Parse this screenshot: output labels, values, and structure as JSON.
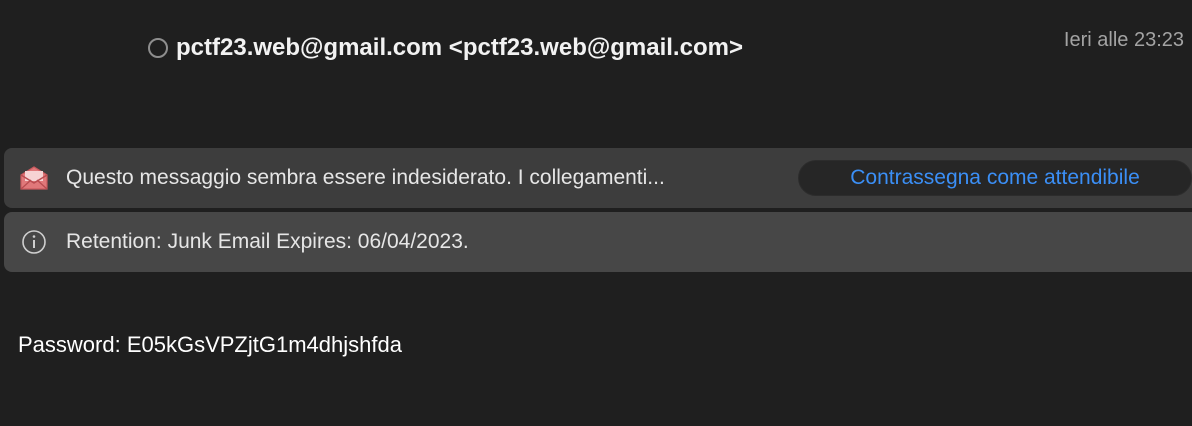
{
  "header": {
    "sender": "pctf23.web@gmail.com <pctf23.web@gmail.com>",
    "date": "Ieri alle 23:23"
  },
  "junk_banner": {
    "icon": "junk-envelope-icon",
    "text": "Questo messaggio sembra essere indesiderato. I collegamenti...",
    "button_label": "Contrassegna come attendibile",
    "button_color": "#3b8ff6",
    "icon_color": "#e0787a"
  },
  "retention_banner": {
    "icon": "info-icon",
    "text": "Retention: Junk Email Expires: 06/04/2023."
  },
  "message": {
    "body": "Password: E05kGsVPZjtG1m4dhjshfda"
  }
}
